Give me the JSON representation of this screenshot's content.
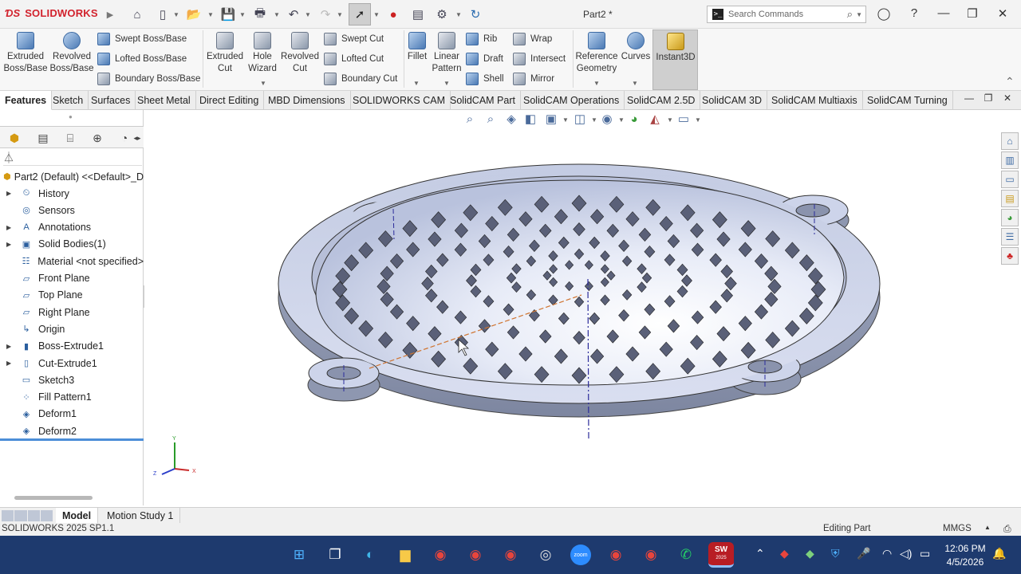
{
  "app": {
    "brand": "SOLIDWORKS",
    "doc_title": "Part2 *"
  },
  "search": {
    "placeholder": "Search Commands"
  },
  "ribbon": {
    "extruded_boss": "Extruded Boss/Base",
    "revolved_boss": "Revolved Boss/Base",
    "swept_boss": "Swept Boss/Base",
    "lofted_boss": "Lofted Boss/Base",
    "boundary_boss": "Boundary Boss/Base",
    "extruded_cut": "Extruded Cut",
    "hole_wizard": "Hole Wizard",
    "revolved_cut": "Revolved Cut",
    "swept_cut": "Swept Cut",
    "lofted_cut": "Lofted Cut",
    "boundary_cut": "Boundary Cut",
    "fillet": "Fillet",
    "linear_pattern": "Linear Pattern",
    "rib": "Rib",
    "draft": "Draft",
    "shell": "Shell",
    "wrap": "Wrap",
    "intersect": "Intersect",
    "mirror": "Mirror",
    "reference_geometry": "Reference Geometry",
    "curves": "Curves",
    "instant3d": "Instant3D"
  },
  "tabs": [
    "Features",
    "Sketch",
    "Surfaces",
    "Sheet Metal",
    "Direct Editing",
    "MBD Dimensions",
    "SOLIDWORKS CAM",
    "SolidCAM Part",
    "SolidCAM Operations",
    "SolidCAM 2.5D",
    "SolidCAM 3D",
    "SolidCAM Multiaxis",
    "SolidCAM Turning"
  ],
  "tree": {
    "root": "Part2 (Default) <<Default>_D",
    "items": [
      {
        "label": "History",
        "icon": "history-icon",
        "exp": true
      },
      {
        "label": "Sensors",
        "icon": "sensors-icon",
        "exp": false
      },
      {
        "label": "Annotations",
        "icon": "annotations-icon",
        "exp": true
      },
      {
        "label": "Solid Bodies(1)",
        "icon": "solid-bodies-icon",
        "exp": true
      },
      {
        "label": "Material <not specified>",
        "icon": "material-icon",
        "exp": false
      },
      {
        "label": "Front Plane",
        "icon": "plane-icon",
        "exp": false
      },
      {
        "label": "Top Plane",
        "icon": "plane-icon",
        "exp": false
      },
      {
        "label": "Right Plane",
        "icon": "plane-icon",
        "exp": false
      },
      {
        "label": "Origin",
        "icon": "origin-icon",
        "exp": false
      },
      {
        "label": "Boss-Extrude1",
        "icon": "boss-extrude-icon",
        "exp": true
      },
      {
        "label": "Cut-Extrude1",
        "icon": "cut-extrude-icon",
        "exp": true
      },
      {
        "label": "Sketch3",
        "icon": "sketch-icon",
        "exp": false
      },
      {
        "label": "Fill Pattern1",
        "icon": "fill-pattern-icon",
        "exp": false
      },
      {
        "label": "Deform1",
        "icon": "deform-icon",
        "exp": false
      },
      {
        "label": "Deform2",
        "icon": "deform-icon",
        "exp": false
      }
    ]
  },
  "bottom_tabs": {
    "model": "Model",
    "motion": "Motion Study 1"
  },
  "status": {
    "version": "SOLIDWORKS 2025 SP1.1",
    "mode": "Editing Part",
    "units": "MMGS"
  },
  "triad": {
    "y": "Y",
    "x": "X",
    "z": "Z"
  },
  "taskbar": {
    "time": "12:06 PM",
    "date": "4/5/2026",
    "sw_badge": "SW",
    "sw_year": "2025",
    "zoom_label": "zoom"
  },
  "colors": {
    "accent_red": "#d2222d",
    "taskbar": "#1e3a6e",
    "part_blue": "#c9d3ea"
  }
}
